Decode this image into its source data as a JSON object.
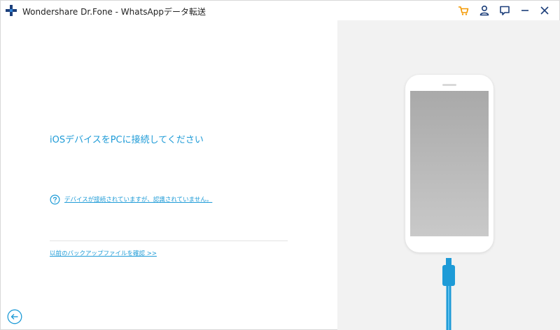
{
  "window": {
    "title": "Wondershare Dr.Fone - WhatsAppデータ転送",
    "accent_color": "#1e9bd7",
    "cart_color": "#f39800"
  },
  "titlebar": {
    "logo_icon": "drfone-plus-logo",
    "buttons": [
      "cart-icon",
      "account-icon",
      "feedback-icon",
      "minimize-icon",
      "close-icon"
    ]
  },
  "main": {
    "connect_prompt": "iOSデバイスをPCに接続してください",
    "help_link": "デバイスが接続されていますが、認識されていません。",
    "backup_link": "以前のバックアップファイルを確認 >>"
  },
  "illustration": {
    "device": "phone-with-lightning-cable",
    "cable_color": "#1e9bd7"
  }
}
